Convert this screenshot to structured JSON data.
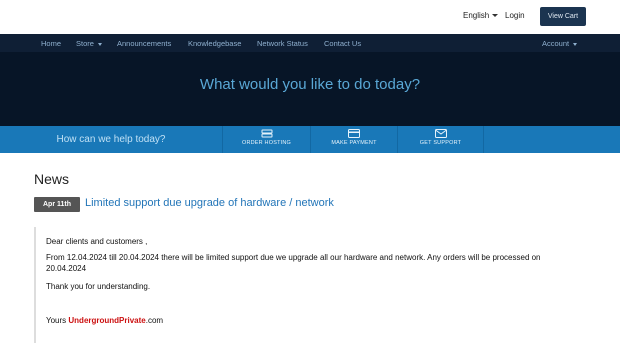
{
  "topbar": {
    "language": "English",
    "login": "Login",
    "view_cart": "View Cart"
  },
  "nav": {
    "items": [
      "Home",
      "Store",
      "Announcements",
      "Knowledgebase",
      "Network Status",
      "Contact Us"
    ],
    "account": "Account"
  },
  "hero": {
    "title": "What would you like to do today?"
  },
  "actions": {
    "help_text": "How can we help today?",
    "items": [
      {
        "label": "ORDER HOSTING",
        "icon": "server-icon"
      },
      {
        "label": "MAKE PAYMENT",
        "icon": "credit-card-icon"
      },
      {
        "label": "GET SUPPORT",
        "icon": "envelope-icon"
      }
    ]
  },
  "news": {
    "heading": "News",
    "date": "Apr 11th",
    "title": "Limited support due upgrade of hardware / network",
    "greeting": "Dear clients and customers ,",
    "body": "From 12.04.2024 till 20.04.2024 there will be limited support due we upgrade all our hardware and network. Any orders will be processed on 20.04.2024",
    "thanks": "Thank you for understanding.",
    "signoff_prefix": "Yours ",
    "signoff_brand": "UndergroundPrivate",
    "signoff_suffix": ".com"
  },
  "colors": {
    "nav_bg": "#0f1f35",
    "hero_bg": "#071527",
    "hero_text": "#5aa8d6",
    "action_bar": "#1978b8",
    "link": "#2275b8",
    "brand": "#cc1010"
  }
}
